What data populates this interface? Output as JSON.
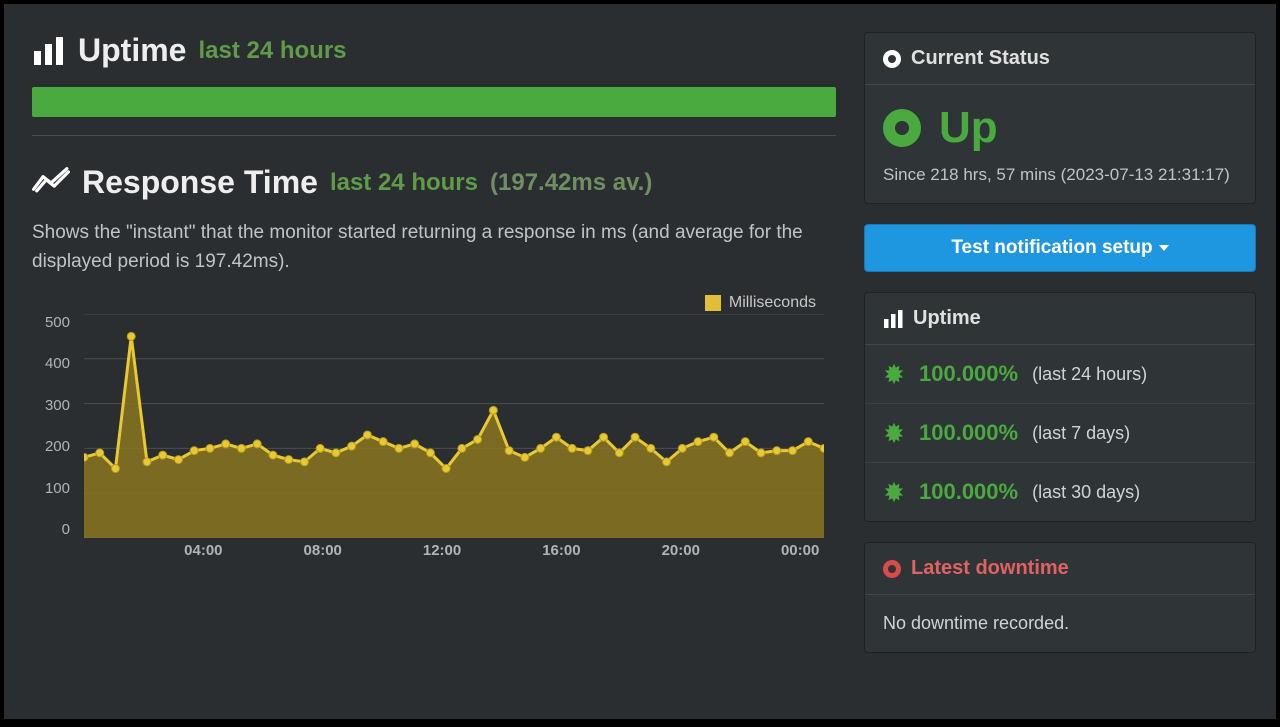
{
  "uptime_section": {
    "title": "Uptime",
    "subtitle": "last 24 hours"
  },
  "response_section": {
    "title": "Response Time",
    "subtitle": "last 24 hours",
    "avg_label": "(197.42ms av.)",
    "description": "Shows the \"instant\" that the monitor started returning a response in ms (and average for the displayed period is 197.42ms).",
    "legend": "Milliseconds"
  },
  "status_panel": {
    "head": "Current Status",
    "state": "Up",
    "since": "Since 218 hrs, 57 mins (2023-07-13 21:31:17)"
  },
  "test_button": "Test notification setup",
  "uptime_panel": {
    "head": "Uptime",
    "rows": [
      {
        "pct": "100.000%",
        "label": "(last 24 hours)"
      },
      {
        "pct": "100.000%",
        "label": "(last 7 days)"
      },
      {
        "pct": "100.000%",
        "label": "(last 30 days)"
      }
    ]
  },
  "downtime_panel": {
    "head": "Latest downtime",
    "body": "No downtime recorded."
  },
  "chart_data": {
    "type": "area",
    "ylabel": "ms",
    "ylim": [
      0,
      500
    ],
    "yticks": [
      0,
      100,
      200,
      300,
      400,
      500
    ],
    "xticks": [
      "04:00",
      "08:00",
      "12:00",
      "16:00",
      "20:00",
      "00:00"
    ],
    "series": [
      {
        "name": "Milliseconds",
        "color": "#e0be38",
        "values": [
          180,
          190,
          155,
          450,
          170,
          185,
          175,
          195,
          200,
          210,
          200,
          210,
          185,
          175,
          170,
          200,
          190,
          205,
          230,
          215,
          200,
          210,
          190,
          155,
          200,
          220,
          285,
          195,
          180,
          200,
          225,
          200,
          195,
          225,
          190,
          225,
          200,
          170,
          200,
          215,
          225,
          190,
          215,
          190,
          195,
          195,
          215,
          200
        ]
      }
    ]
  }
}
